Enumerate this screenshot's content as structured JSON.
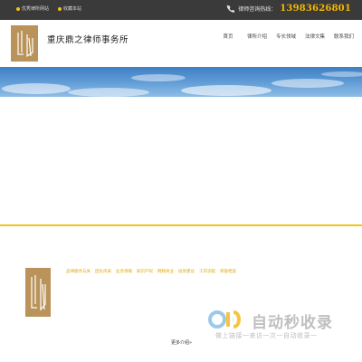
{
  "topbar": {
    "links": [
      {
        "label": "优秀律所网站",
        "icon": "bulb-icon",
        "color": "#f0c419"
      },
      {
        "label": "收藏本站",
        "icon": "star-icon",
        "color": "#f0c419"
      }
    ],
    "hotline_label": "律师咨询热线：",
    "phone": "13983626801",
    "colors": {
      "background": "#3a3a3a",
      "phone": "#f5b800"
    }
  },
  "header": {
    "firm_name": "重庆鼎之律师事务所",
    "logo_icon": "firm-logo-icon",
    "nav": [
      {
        "label": "首页"
      },
      {
        "label": "律所介绍"
      },
      {
        "label": "专长领域"
      },
      {
        "label": "法律文集"
      },
      {
        "label": "联系我们"
      }
    ]
  },
  "footer": {
    "links": [
      {
        "label": "品律服务与关"
      },
      {
        "label": "团队风采"
      },
      {
        "label": "业务领域"
      },
      {
        "label": "知识产权"
      },
      {
        "label": "网络商业"
      },
      {
        "label": "投诉建议"
      },
      {
        "label": "工作流程"
      },
      {
        "label": "荣誉档案"
      }
    ],
    "more_label": "更多介绍»"
  },
  "watermark": {
    "title": "自动秒收录",
    "subtitle": "做上链接一来访一次一自动收录一"
  },
  "colors": {
    "accent": "#f0c419",
    "logo_gold": "#b9935a",
    "banner_blue": "#4f8fcf"
  }
}
